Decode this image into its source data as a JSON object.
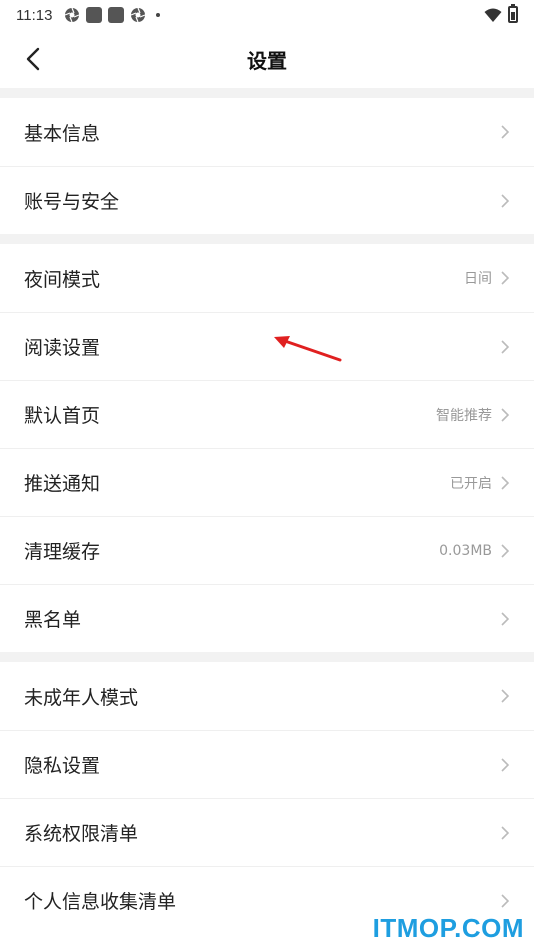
{
  "status_bar": {
    "time": "11:13"
  },
  "nav": {
    "title": "设置"
  },
  "groups": [
    {
      "items": [
        {
          "label": "基本信息",
          "value": ""
        },
        {
          "label": "账号与安全",
          "value": ""
        }
      ]
    },
    {
      "items": [
        {
          "label": "夜间模式",
          "value": "日间"
        },
        {
          "label": "阅读设置",
          "value": ""
        },
        {
          "label": "默认首页",
          "value": "智能推荐"
        },
        {
          "label": "推送通知",
          "value": "已开启"
        },
        {
          "label": "清理缓存",
          "value": "0.03MB"
        },
        {
          "label": "黑名单",
          "value": ""
        }
      ]
    },
    {
      "items": [
        {
          "label": "未成年人模式",
          "value": ""
        },
        {
          "label": "隐私设置",
          "value": ""
        },
        {
          "label": "系统权限清单",
          "value": ""
        },
        {
          "label": "个人信息收集清单",
          "value": ""
        }
      ]
    }
  ],
  "watermark": "ITMOP.COM",
  "colors": {
    "annotation_arrow": "#e02020",
    "watermark": "#1e9ee0"
  }
}
